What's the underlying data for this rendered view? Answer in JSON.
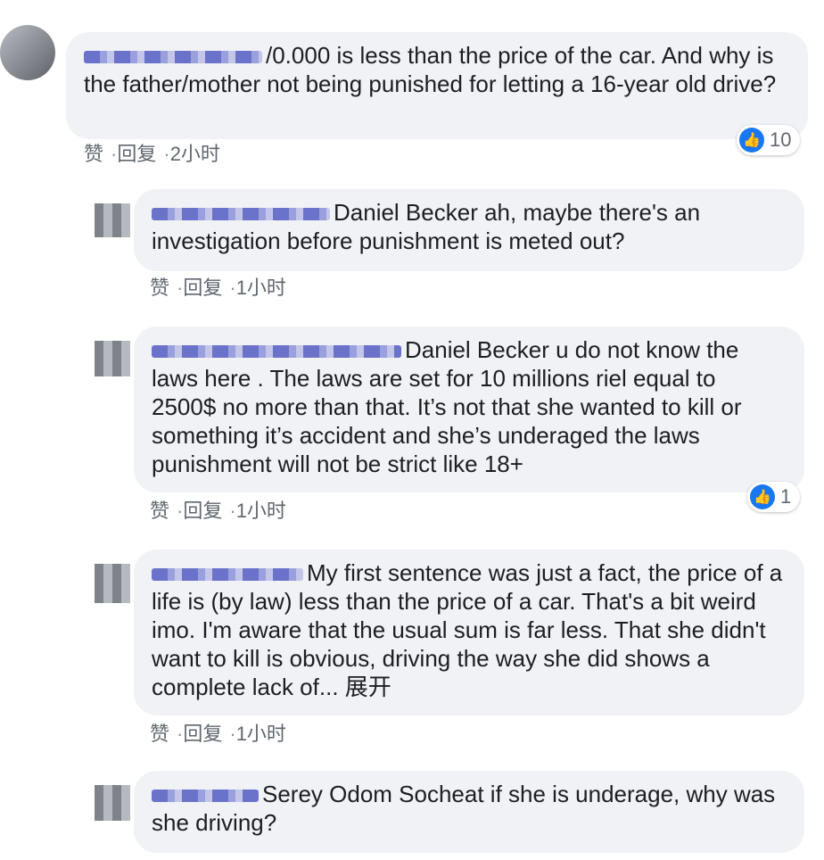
{
  "comments": [
    {
      "text": "/0.000 is less than the price of the car. And why is the father/mother not being punished for letting a 16-year old drive?",
      "like_label": "赞",
      "reply_label": "回复",
      "time": "2小时",
      "reaction_count": "10"
    },
    {
      "text": "Daniel Becker ah, maybe there's an investigation before punishment is meted out?",
      "like_label": "赞",
      "reply_label": "回复",
      "time": "1小时"
    },
    {
      "text": "Daniel Becker u do not know the laws here . The laws are set for 10 millions riel equal to 2500$ no more than that. It’s not that she wanted to kill or something it’s accident and she’s underaged the laws punishment will not be strict like 18+",
      "like_label": "赞",
      "reply_label": "回复",
      "time": "1小时",
      "reaction_count": "1"
    },
    {
      "text": "My first sentence was just a fact, the price of a life is (by law) less than the price of a car. That's a bit weird imo. I'm aware that the usual sum is far less. That she didn't want to kill is obvious, driving the way she did shows a complete lack of...",
      "see_more": "展开",
      "like_label": "赞",
      "reply_label": "回复",
      "time": "1小时"
    },
    {
      "text": "Serey Odom Socheat if she is underage, why was she driving?"
    }
  ],
  "colors": {
    "bubble": "#f0f2f5",
    "like": "#1877f2",
    "meta": "#606770"
  },
  "icons": {
    "reaction": "thumbs-up-icon"
  }
}
